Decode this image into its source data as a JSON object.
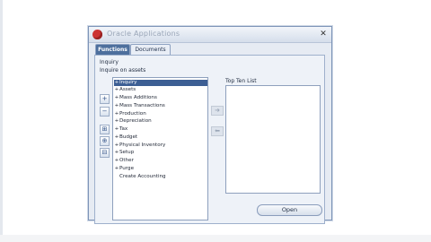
{
  "window": {
    "title": "Oracle Applications"
  },
  "tabs": [
    {
      "label": "Functions",
      "active": true
    },
    {
      "label": "Documents",
      "active": false
    }
  ],
  "navigator": {
    "heading": "Inquiry",
    "description": "Inquire on assets",
    "items": [
      {
        "label": "Inquiry",
        "expandable": true,
        "selected": true
      },
      {
        "label": "Assets",
        "expandable": true
      },
      {
        "label": "Mass Additions",
        "expandable": true
      },
      {
        "label": "Mass Transactions",
        "expandable": true
      },
      {
        "label": "Production",
        "expandable": true
      },
      {
        "label": "Depreciation",
        "expandable": true
      },
      {
        "label": "Tax",
        "expandable": true
      },
      {
        "label": "Budget",
        "expandable": true
      },
      {
        "label": "Physical Inventory",
        "expandable": true
      },
      {
        "label": "Setup",
        "expandable": true
      },
      {
        "label": "Other",
        "expandable": true
      },
      {
        "label": "Purge",
        "expandable": true
      },
      {
        "label": "Create Accounting",
        "expandable": false
      }
    ],
    "top_ten_label": "Top Ten List",
    "open_label": "Open"
  },
  "icons": {
    "expand_all": "expand-all-icon",
    "collapse_all": "collapse-all-icon",
    "expand_branch": "expand-branch-icon",
    "move_right": "arrow-right-icon",
    "move_left": "arrow-left-icon"
  },
  "colors": {
    "selection": "#3d5f94",
    "tab_active": "#4d6f9d"
  }
}
